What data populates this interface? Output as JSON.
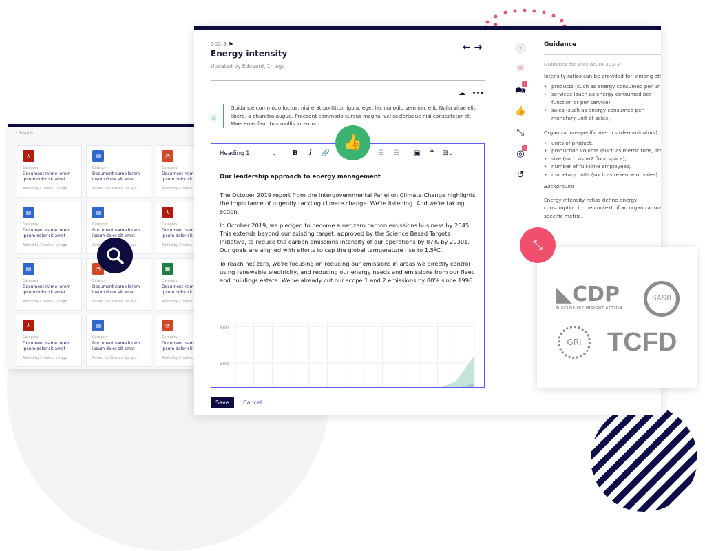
{
  "library": {
    "search_placeholder": "Search",
    "cards": [
      {
        "type": "pdf",
        "category": "Category",
        "name": "Document name lorem ipsum dolor sit amet",
        "added": "Added by Charles, 1d ago"
      },
      {
        "type": "doc",
        "category": "Category",
        "name": "Document name lorem ipsum dolor sit amet",
        "added": "Added by Charles, 1d ago"
      },
      {
        "type": "ppt",
        "category": "Category",
        "name": "Document name lorem ipsum dolor sit amet",
        "added": "Added by Charles, 1d ago"
      },
      {
        "type": "doc",
        "category": "Category",
        "name": "Document name lorem ipsum dolor sit amet",
        "added": "Added by Charles, 1d ago"
      },
      {
        "type": "doc",
        "category": "Category",
        "name": "Document name lorem ipsum dolor sit amet",
        "added": "Added by Charles, 1d ago"
      },
      {
        "type": "pdf",
        "category": "Category",
        "name": "Document name lorem ipsum dolor sit amet",
        "added": "Added by Charles, 1d ago"
      },
      {
        "type": "doc",
        "category": "Category",
        "name": "Document name lorem ipsum dolor sit amet",
        "added": "Added by Charles, 1d ago"
      },
      {
        "type": "ppt",
        "category": "Category",
        "name": "Document name lorem ipsum dolor sit amet",
        "added": "Added by Charles, 1d ago"
      },
      {
        "type": "sheet",
        "category": "Category",
        "name": "Document name lorem ipsum dolor sit amet",
        "added": "Added by Charles, 1d ago"
      },
      {
        "type": "pdf",
        "category": "Category",
        "name": "Document name lorem ipsum dolor sit amet",
        "added": "Added by Charles, 1d ago"
      },
      {
        "type": "doc",
        "category": "Category",
        "name": "Document name lorem ipsum dolor sit amet",
        "added": "Added by Charles, 1d ago"
      },
      {
        "type": "ppt",
        "category": "Category",
        "name": "Document name lorem ipsum dolor sit amet",
        "added": "Added by Charles, 1d ago"
      }
    ],
    "type_colors": {
      "pdf": "#b31b0f",
      "doc": "#2f66d0",
      "ppt": "#d24726",
      "sheet": "#1e7d45"
    }
  },
  "disclosure": {
    "code": "302-3",
    "title": "Energy intensity",
    "updated": "Updated by Edouard, 1h ago",
    "guidance": "Guidance commodo luctus, nisi erat porttitor ligula, eget lacinia odio sem nec elit. Nulla vitae elit libero, a pharetra augue. Praesent commodo cursus magna, vel scelerisque nisl consectetur et. Maecenas faucibus mollis interdum."
  },
  "editor": {
    "style": "Heading 1",
    "heading": "Our leadership approach to energy management",
    "paragraphs": [
      "The October 2019 report from the Intergovernmental Panel on Climate Change highlights the importance of urgently tackling climate change. We're listening. And we're taking action.",
      "In October 2019, we pledged to become a net zero carbon emissions business by 2045. This extends beyond our existing target, approved by the Science Based Targets Initiative, to reduce the carbon emissions intensity of our operations by 87% by 20301. Our goals are aligned with efforts to cap the global temperature rise to 1.5ºC.",
      "To reach net zero, we're focusing on reducing our emissions in areas we directly control – using renewable electricity, and reducing our energy needs and emissions from our fleet and buildings estate. We've already cut our scope 1 and 2 emissions by 80% since 1996."
    ],
    "save": "Save",
    "cancel": "Cancel"
  },
  "chart_data": {
    "type": "area",
    "y_ticks": [
      "400",
      "300"
    ],
    "ylim": [
      230,
      410
    ],
    "grid": true,
    "series": [
      {
        "values": [
          null,
          null,
          null,
          null,
          null,
          null,
          null,
          null,
          null,
          null,
          null,
          230,
          250,
          320
        ],
        "color": "#c5e3dc"
      },
      {
        "values": [
          null,
          null,
          null,
          null,
          null,
          null,
          null,
          null,
          null,
          null,
          null,
          null,
          null,
          245
        ],
        "color": "#a7cbc9"
      }
    ]
  },
  "sidebar": {
    "title": "Guidance",
    "subtitle": "Guidance for Disclosure 302-3",
    "badges": {
      "comments": "3",
      "targets": "3"
    },
    "intro": "Intensity ratios can be provided for, among others:",
    "list1": [
      "products (such as energy consumed per unit produced);",
      "services (such as energy consumed per function or per service);",
      "sales (such as energy consumed per monetary unit of sales)."
    ],
    "intro2": "Organization-specific metrics (denominators) can include:",
    "list2": [
      "units of product;",
      "production volume (such as metric tons, liters, or MWh);",
      "size (such as m2 floor space);",
      "number of full-time employees;",
      "monetary units (such as revenue or sales)."
    ],
    "background_label": "Background",
    "background": "Energy intensity ratios define energy consumption in the context of an organization-specific metric."
  },
  "logos": [
    "CDP",
    "SASB",
    "GRI",
    "TCFD"
  ],
  "colors": {
    "navy": "#0c0c3e",
    "green": "#3cb371",
    "coral": "#f0506e",
    "accent": "#5a5af0"
  }
}
